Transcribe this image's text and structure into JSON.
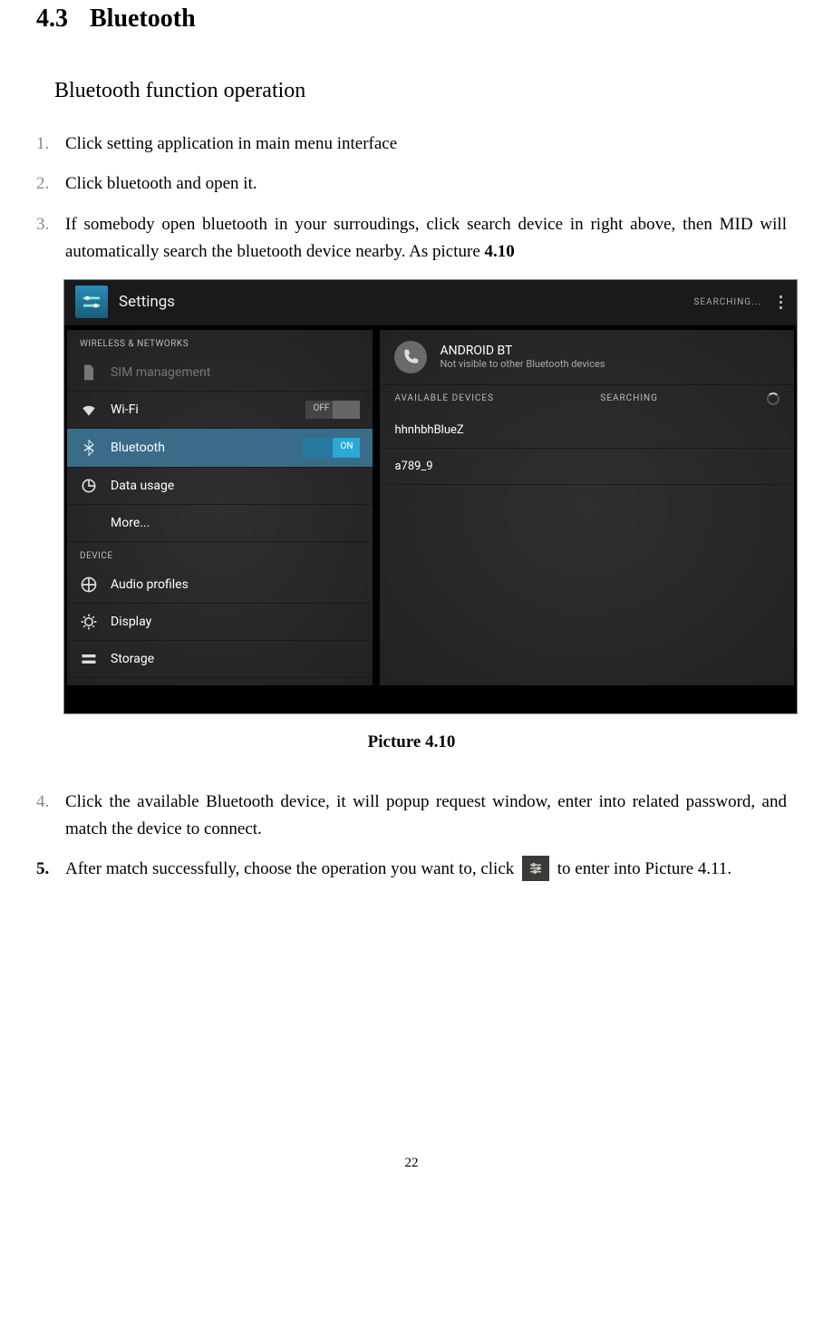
{
  "section": {
    "number": "4.3",
    "title": "Bluetooth"
  },
  "subheading": "Bluetooth function operation",
  "steps": [
    {
      "num": "1.",
      "text": "Click setting application in main menu interface"
    },
    {
      "num": "2.",
      "text": "Click bluetooth and open it."
    },
    {
      "num": "3.",
      "text_a": "If somebody open bluetooth in your surroudings, click search device in right above, then MID will automatically search the bluetooth device nearby. As picture ",
      "bold": "4.10"
    },
    {
      "num": "4.",
      "text": "Click the available Bluetooth device, it will popup request window, enter into related password, and match the device to connect."
    },
    {
      "num": "5.",
      "text_a": "After match successfully, choose the operation you want to, click ",
      "text_b": " to enter into Picture 4.11."
    }
  ],
  "screenshot": {
    "topbar": {
      "title": "Settings",
      "action": "SEARCHING..."
    },
    "left": {
      "header": "WIRELESS & NETWORKS",
      "items": [
        {
          "label": "SIM management",
          "dim": true
        },
        {
          "label": "Wi-Fi",
          "toggle": "OFF"
        },
        {
          "label": "Bluetooth",
          "toggle": "ON",
          "active": true
        },
        {
          "label": "Data usage"
        },
        {
          "label": "More..."
        }
      ],
      "header2": "DEVICE",
      "items2": [
        {
          "label": "Audio profiles"
        },
        {
          "label": "Display"
        },
        {
          "label": "Storage"
        }
      ]
    },
    "right": {
      "bt_name": "ANDROID BT",
      "bt_sub": "Not visible to other Bluetooth devices",
      "available": "AVAILABLE DEVICES",
      "searching": "SEARCHING",
      "devices": [
        "hhnhbhBlueZ",
        "a789_9"
      ]
    }
  },
  "caption": "Picture 4.10",
  "page": "22"
}
